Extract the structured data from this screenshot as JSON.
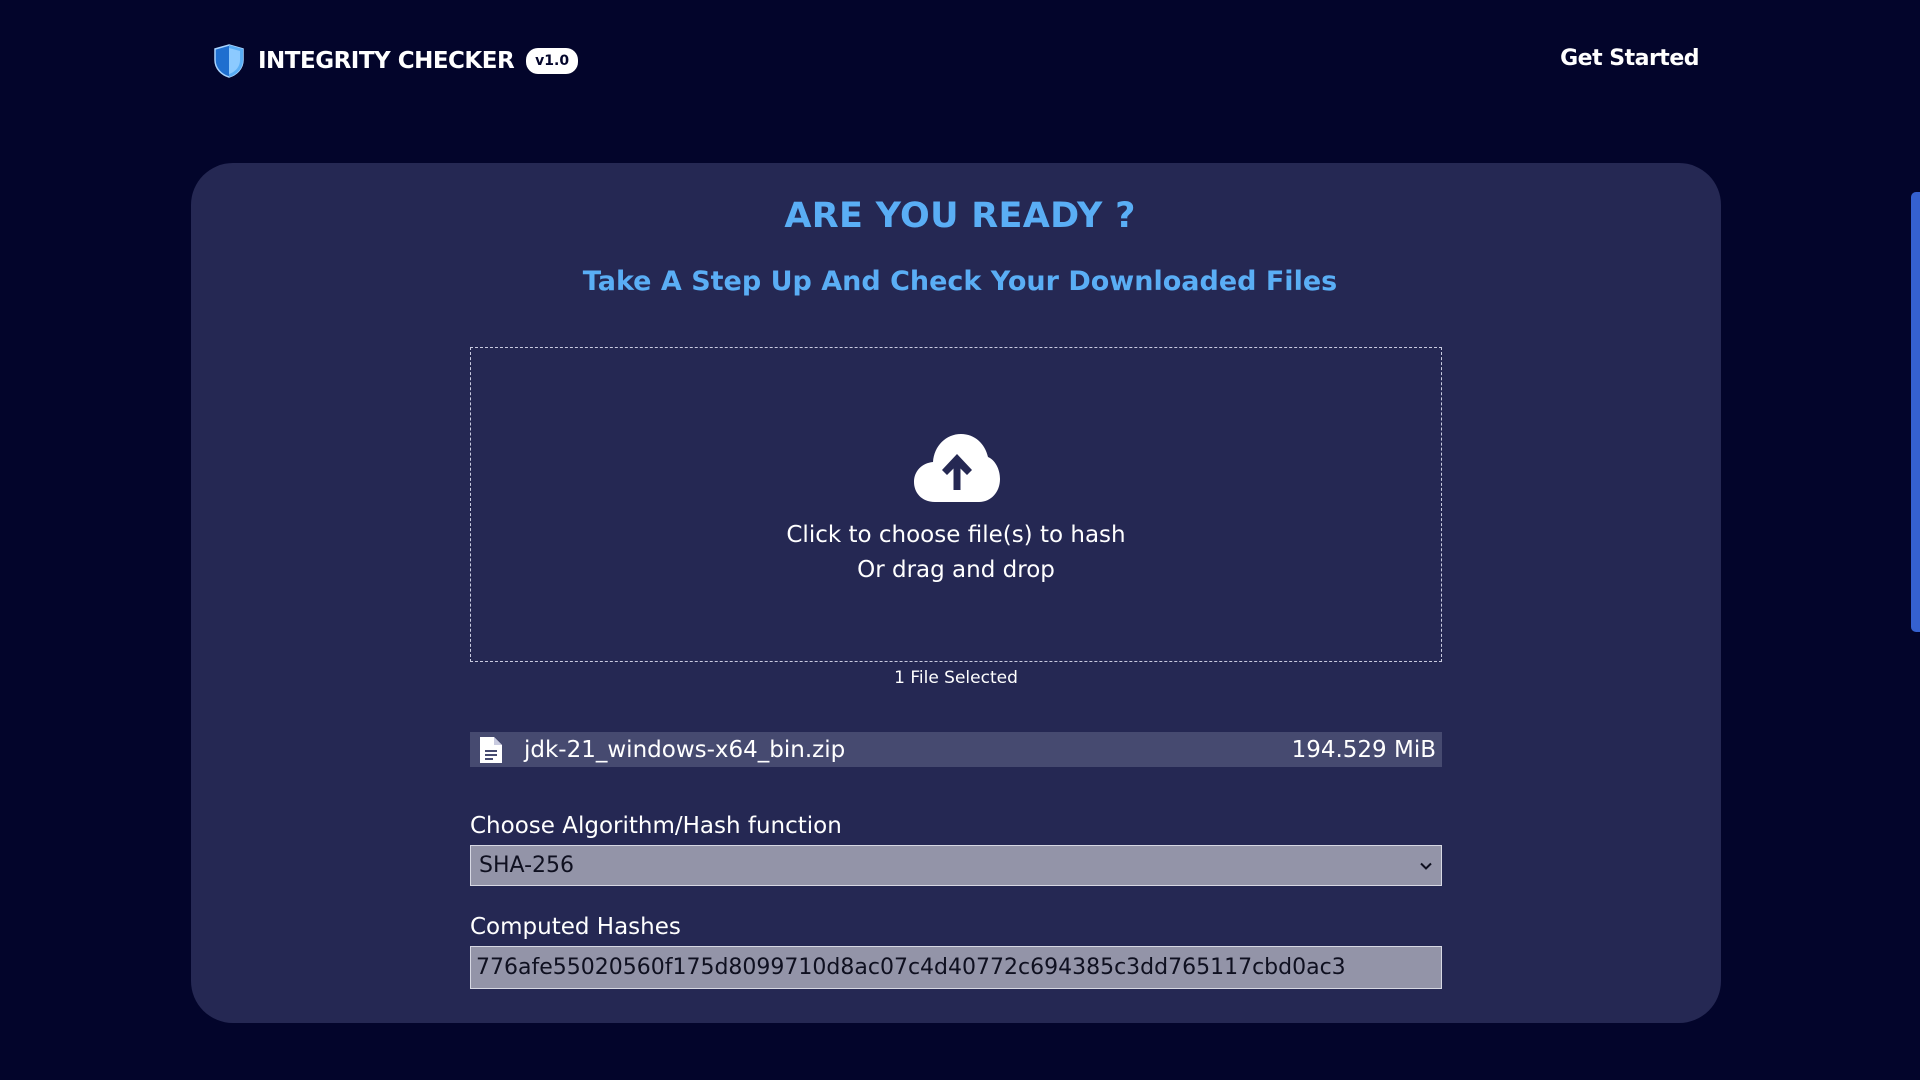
{
  "header": {
    "brand_name": "INTEGRITY CHECKER",
    "version": "v1.0",
    "nav_cta": "Get Started"
  },
  "main": {
    "heading": "ARE YOU READY ?",
    "subheading": "Take A Step Up And Check Your Downloaded Files",
    "dropzone": {
      "line1": "Click to choose file(s) to hash",
      "line2": "Or drag and drop"
    },
    "file_count": "1 File Selected",
    "files": [
      {
        "name": "jdk-21_windows-x64_bin.zip",
        "size": "194.529 MiB"
      }
    ],
    "algorithm": {
      "label": "Choose Algorithm/Hash function",
      "selected": "SHA-256"
    },
    "hashes": {
      "label": "Computed Hashes",
      "value": "776afe55020560f175d8099710d8ac07c4d40772c694385c3dd765117cbd0ac3"
    }
  },
  "colors": {
    "background": "#03052b",
    "card": "#252853",
    "accent": "#5aaef5",
    "file_row": "#464a70",
    "field": "#9394a8",
    "scrollbar": "#3561d0"
  },
  "icons": [
    "shield-icon",
    "cloud-upload-icon",
    "file-icon",
    "chevron-down-icon"
  ]
}
